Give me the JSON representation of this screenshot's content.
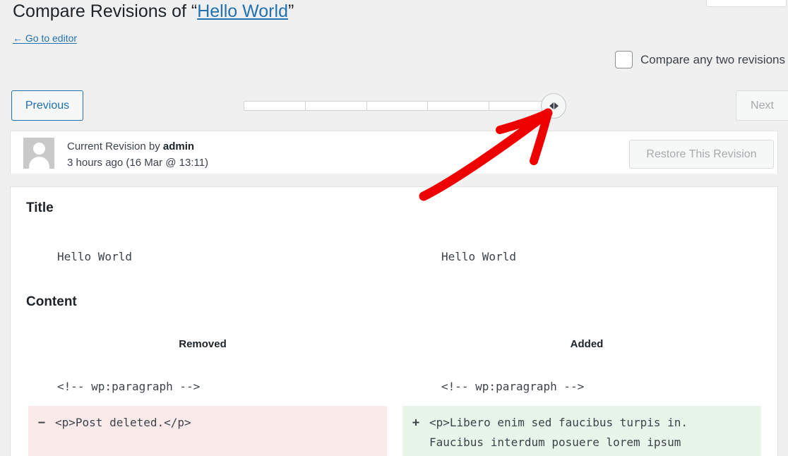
{
  "header": {
    "title_prefix": "Compare Revisions of “",
    "title_link": "Hello World",
    "title_suffix": "”",
    "back_link": "← Go to editor"
  },
  "compare_toggle": {
    "label": "Compare any two revisions",
    "checked": false,
    "checkbox_icon": "checkbox-unchecked-icon"
  },
  "nav": {
    "previous_label": "Previous",
    "next_label": "Next",
    "next_disabled": true,
    "slider": {
      "segments": 5,
      "handle_position": "right-end",
      "handle_icon": "left-right-arrows-icon"
    }
  },
  "revision_bar": {
    "avatar_icon": "user-avatar-placeholder-icon",
    "line1_prefix": "Current Revision by ",
    "author": "admin",
    "line2": "3 hours ago (16 Mar @ 13:11)",
    "restore_label": "Restore This Revision",
    "restore_disabled": true
  },
  "diff": {
    "title_heading": "Title",
    "title_left": "Hello World",
    "title_right": "Hello World",
    "content_heading": "Content",
    "col_removed": "Removed",
    "col_added": "Added",
    "context_left": "<!-- wp:paragraph -->",
    "context_right": "<!-- wp:paragraph -->",
    "removed_sign": "−",
    "removed_text": "<p>Post deleted.</p>",
    "added_sign": "+",
    "added_text": "<p>Libero enim sed faucibus turpis in.\nFaucibus interdum posuere lorem ipsum"
  },
  "annotation": {
    "arrow_icon": "red-arrow-annotation-icon",
    "color": "#ee0000"
  },
  "colors": {
    "page_bg": "#f0f0f1",
    "panel_bg": "#ffffff",
    "link": "#2271b1",
    "removed_bg": "#fbeaea",
    "added_bg": "#e8f5ea",
    "disabled_text": "#a7aaad"
  }
}
